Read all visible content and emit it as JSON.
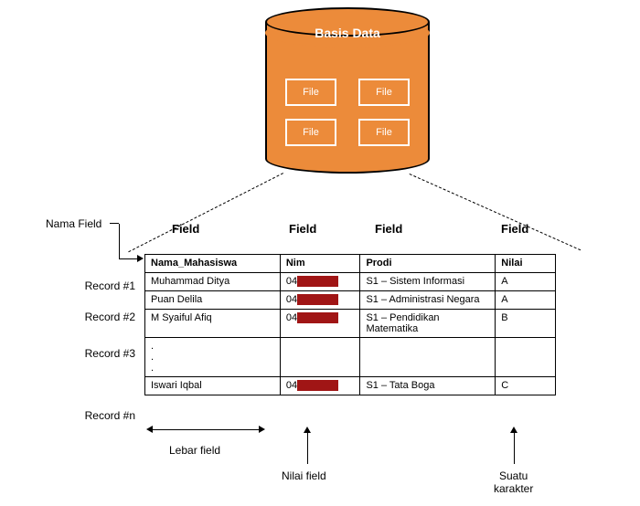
{
  "db": {
    "title": "Basis Data",
    "file_label": "File"
  },
  "labels": {
    "nama_field": "Nama Field",
    "field": "Field",
    "record_prefix": "Record #",
    "record_n": "Record #n",
    "lebar_field": "Lebar field",
    "nilai_field": "Nilai field",
    "suatu_karakter": "Suatu\nkarakter"
  },
  "table": {
    "headers": [
      "Nama_Mahasiswa",
      "Nim",
      "Prodi",
      "Nilai"
    ],
    "rows": [
      {
        "nama": "Muhammad Ditya",
        "nim_prefix": "04",
        "prodi": "S1 – Sistem Informasi",
        "nilai": "A"
      },
      {
        "nama": "Puan Delila",
        "nim_prefix": "04",
        "prodi": "S1 – Administrasi Negara",
        "nilai": "A"
      },
      {
        "nama": "M Syaiful Afiq",
        "nim_prefix": "04",
        "prodi": "S1 – Pendidikan Matematika",
        "nilai": "B"
      }
    ],
    "last_row": {
      "nama": "Iswari Iqbal",
      "nim_prefix": "04",
      "prodi": "S1 – Tata Boga",
      "nilai": "C"
    },
    "record_labels": [
      "Record #1",
      "Record #2",
      "Record #3",
      "Record #n"
    ]
  },
  "chart_data": {
    "type": "table",
    "title": "Basis Data — File → Records/Fields",
    "columns": [
      "Nama_Mahasiswa",
      "Nim",
      "Prodi",
      "Nilai"
    ],
    "rows": [
      [
        "Muhammad Ditya",
        "04…",
        "S1 – Sistem Informasi",
        "A"
      ],
      [
        "Puan Delila",
        "04…",
        "S1 – Administrasi Negara",
        "A"
      ],
      [
        "M Syaiful Afiq",
        "04…",
        "S1 – Pendidikan Matematika",
        "B"
      ],
      [
        "Iswari Iqbal",
        "04…",
        "S1 – Tata Boga",
        "C"
      ]
    ],
    "annotations": [
      "Nama Field",
      "Lebar field",
      "Nilai field",
      "Suatu karakter"
    ]
  }
}
